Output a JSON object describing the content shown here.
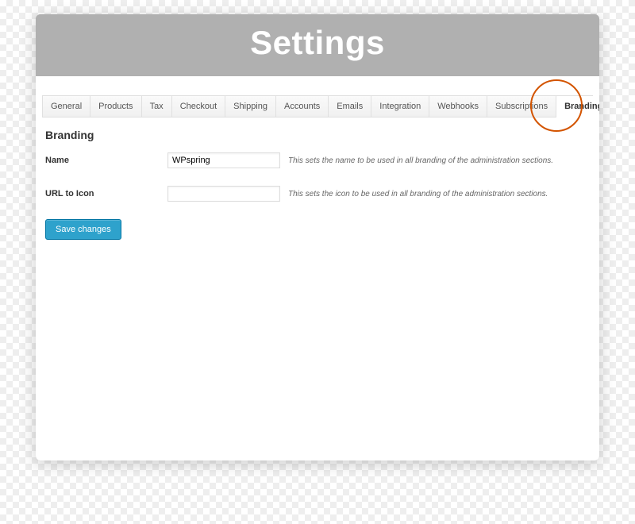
{
  "header": {
    "title": "Settings"
  },
  "tabs": [
    {
      "label": "General",
      "active": false
    },
    {
      "label": "Products",
      "active": false
    },
    {
      "label": "Tax",
      "active": false
    },
    {
      "label": "Checkout",
      "active": false
    },
    {
      "label": "Shipping",
      "active": false
    },
    {
      "label": "Accounts",
      "active": false
    },
    {
      "label": "Emails",
      "active": false
    },
    {
      "label": "Integration",
      "active": false
    },
    {
      "label": "Webhooks",
      "active": false
    },
    {
      "label": "Subscriptions",
      "active": false
    },
    {
      "label": "Branding",
      "active": true
    }
  ],
  "section": {
    "title": "Branding"
  },
  "form": {
    "name": {
      "label": "Name",
      "value": "WPspring",
      "hint": "This sets the name to be used in all branding of the administration sections."
    },
    "url_icon": {
      "label": "URL to Icon",
      "value": "",
      "hint": "This sets the icon to be used in all branding of the administration sections."
    }
  },
  "buttons": {
    "save": "Save changes"
  },
  "colors": {
    "accent": "#2ea2cc",
    "highlight": "#d35400"
  }
}
